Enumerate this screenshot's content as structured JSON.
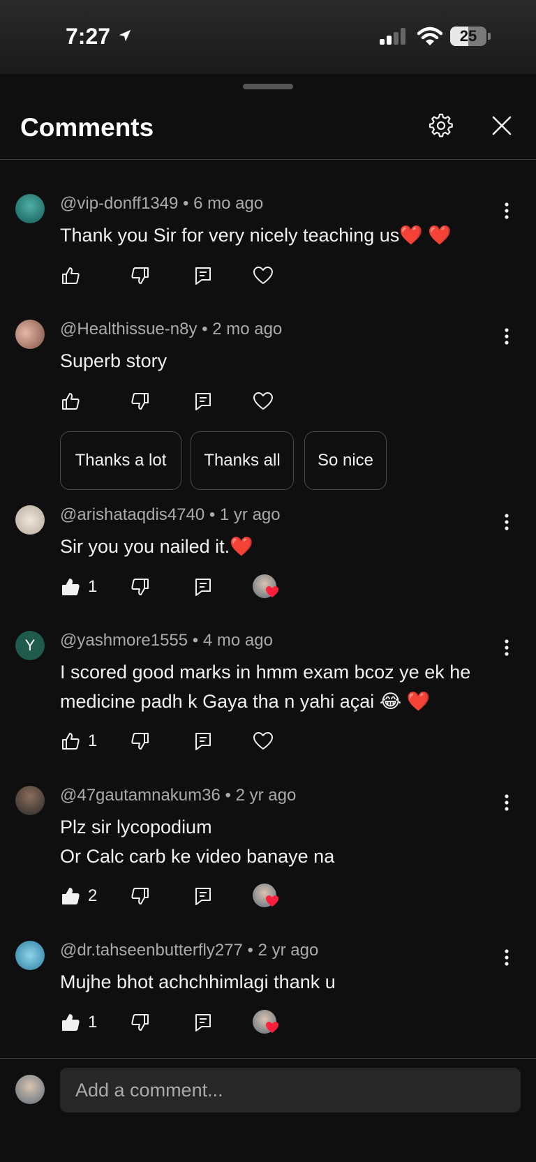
{
  "status": {
    "time": "7:27",
    "battery": "25",
    "battery_level": 0.25
  },
  "header": {
    "title": "Comments"
  },
  "comments": [
    {
      "author": "@vip-donff1349",
      "age": "6 mo ago",
      "meta": "@vip-donff1349 • 6 mo ago",
      "text": "Thank you Sir for very nicely teaching us❤️ ❤️",
      "likes": "",
      "creator_heart": false
    },
    {
      "author": "@Healthissue-n8y",
      "age": "2 mo ago",
      "meta": "@Healthissue-n8y • 2 mo ago",
      "text": "Superb story",
      "likes": "",
      "creator_heart": false
    },
    {
      "author": "@arishataqdis4740",
      "age": "1 yr ago",
      "meta": "@arishataqdis4740 • 1 yr ago",
      "text": "Sir you you nailed it.❤️",
      "likes": "1",
      "creator_heart": true
    },
    {
      "author": "@yashmore1555",
      "age": "4 mo ago",
      "meta": "@yashmore1555 • 4 mo ago",
      "text": "I scored good marks in hmm exam bcoz ye ek he medicine padh k Gaya tha n yahi açai 😂 ❤️",
      "likes": "1",
      "creator_heart": false,
      "avatar_letter": "Y"
    },
    {
      "author": "@47gautamnakum36",
      "age": "2 yr ago",
      "meta": "@47gautamnakum36 • 2 yr ago",
      "line1": "Plz sir lycopodium",
      "line2": "Or Calc carb ke video banaye na",
      "likes": "2",
      "creator_heart": true
    },
    {
      "author": "@dr.tahseenbutterfly277",
      "age": "2 yr ago",
      "meta": "@dr.tahseenbutterfly277 • 2 yr ago",
      "text": "Mujhe bhot achchhimlagi thank u",
      "likes": "1",
      "creator_heart": true
    }
  ],
  "reply_chips": [
    "Thanks a lot",
    "Thanks all",
    "So nice"
  ],
  "composer": {
    "placeholder": "Add a comment..."
  },
  "colors": {
    "background": "#0f0f0f",
    "text": "#f1f1f1",
    "meta": "#aaaaaa",
    "heart": "#ff1f3d",
    "input_bg": "#272727"
  },
  "icons": [
    "location-arrow-icon",
    "signal-icon",
    "wifi-icon",
    "battery-icon",
    "gear-icon",
    "close-icon",
    "more-vertical-icon",
    "thumbs-up-icon",
    "thumbs-down-icon",
    "reply-icon",
    "heart-icon"
  ]
}
